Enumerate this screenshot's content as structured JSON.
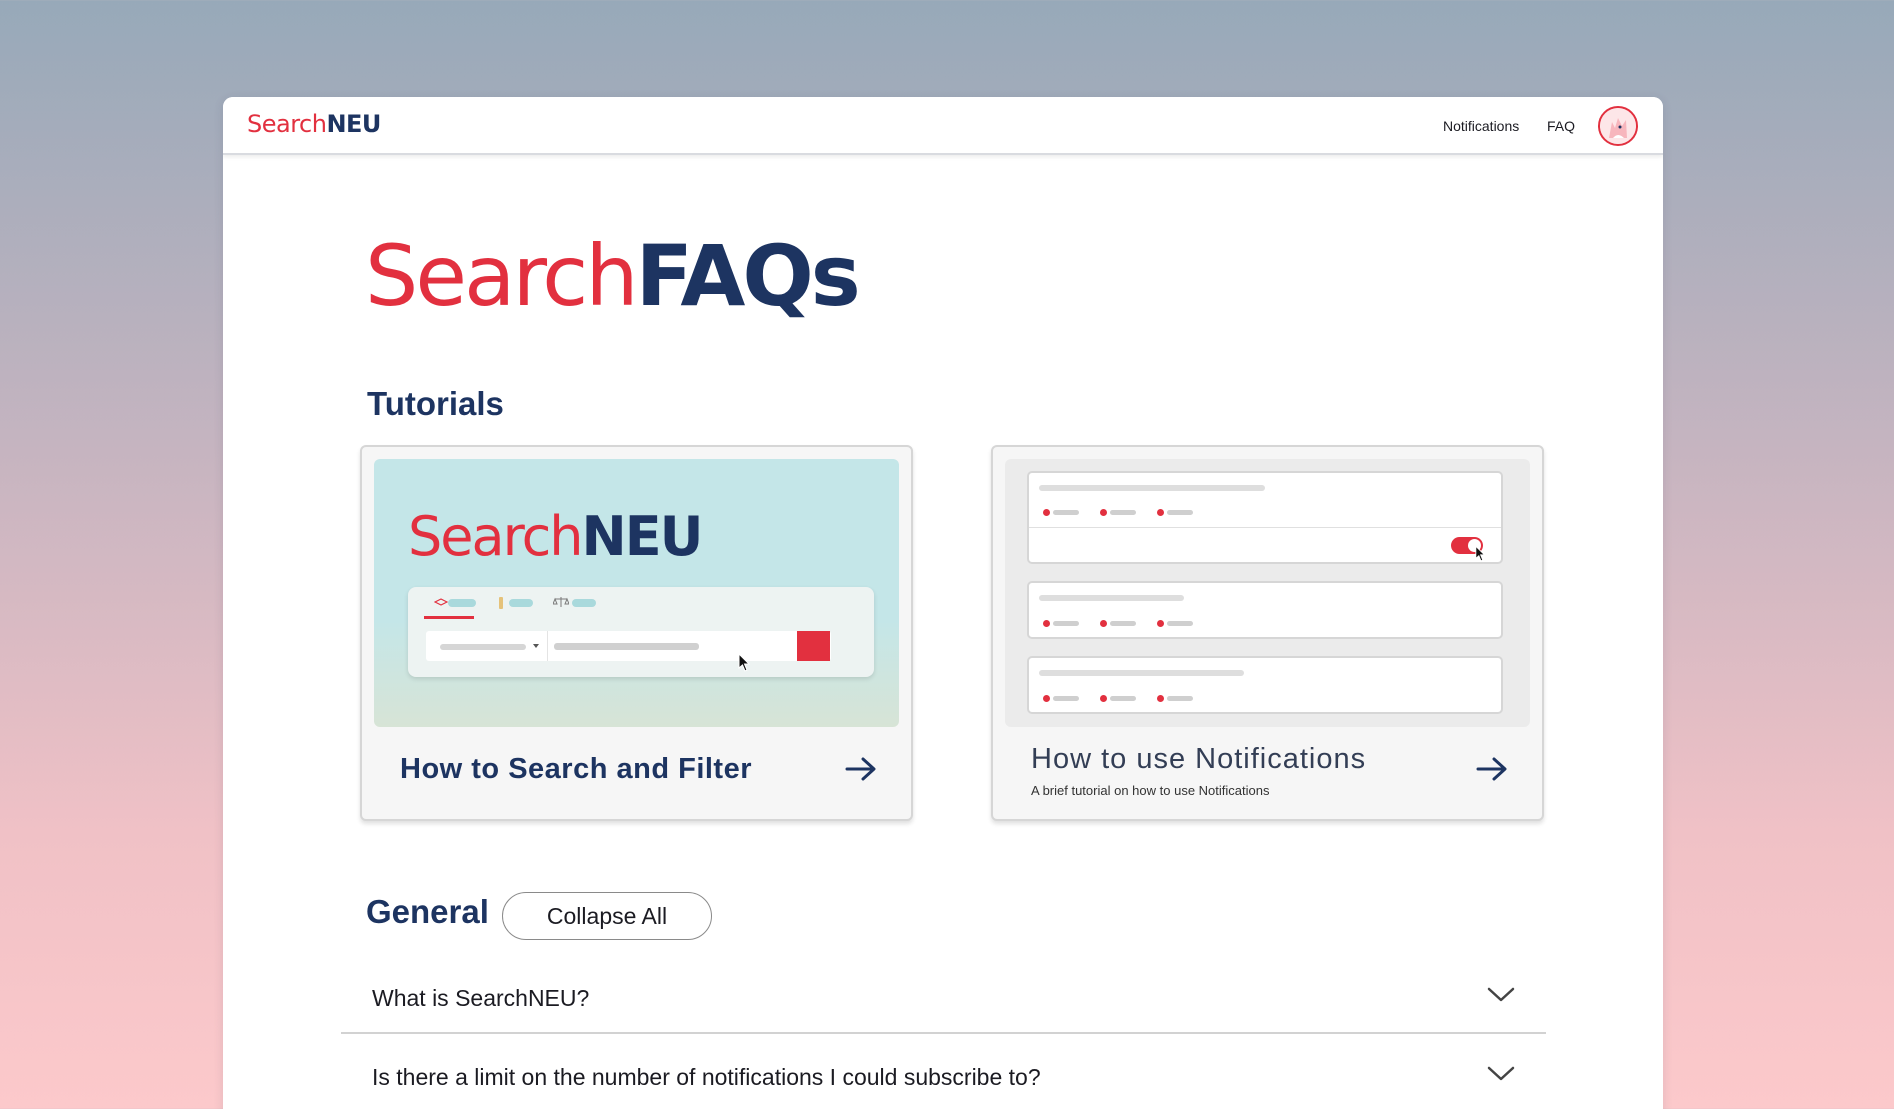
{
  "header": {
    "logo_left": "Search",
    "logo_right": "NEU",
    "nav": [
      "Notifications",
      "FAQ"
    ]
  },
  "hero": {
    "title_left": "Search",
    "title_right": "FAQs"
  },
  "tutorials": {
    "heading": "Tutorials",
    "cards": [
      {
        "title": "How to Search and Filter",
        "thumb_logo_left": "Search",
        "thumb_logo_right": "NEU",
        "icon": "arrow-right-icon"
      },
      {
        "title": "How to use Notifications",
        "subtitle": "A brief tutorial on how to use Notifications",
        "icon": "arrow-right-icon"
      }
    ]
  },
  "general": {
    "heading": "General",
    "collapse_label": "Collapse All",
    "questions": [
      "What is SearchNEU?",
      "Is there a limit on the number of notifications I could subscribe to?"
    ]
  },
  "colors": {
    "brand_red": "#e2303f",
    "brand_navy": "#1d3461"
  }
}
